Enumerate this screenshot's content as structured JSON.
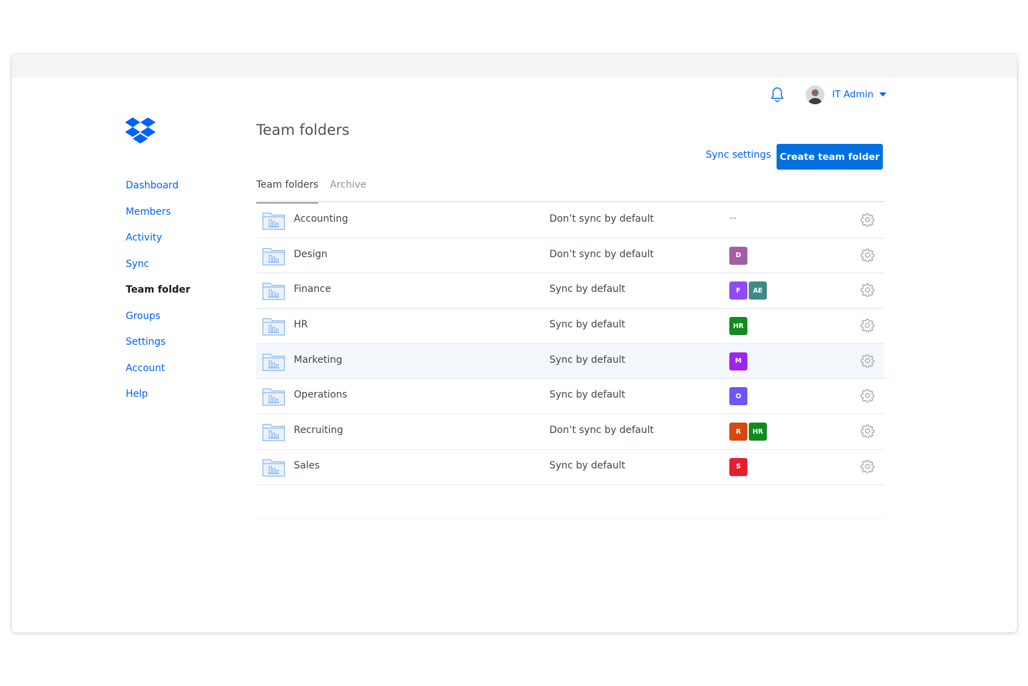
{
  "header": {
    "user_name": "IT Admin",
    "icons": {
      "bell": "bell-icon",
      "avatar": "user-avatar",
      "caret": "chevron-down-icon"
    }
  },
  "brand": {
    "logo": "dropbox-logo",
    "color": "#0061fe"
  },
  "sidebar": {
    "items": [
      {
        "label": "Dashboard",
        "active": false
      },
      {
        "label": "Members",
        "active": false
      },
      {
        "label": "Activity",
        "active": false
      },
      {
        "label": "Sync",
        "active": false
      },
      {
        "label": "Team folder",
        "active": true
      },
      {
        "label": "Groups",
        "active": false
      },
      {
        "label": "Settings",
        "active": false
      },
      {
        "label": "Account",
        "active": false
      },
      {
        "label": "Help",
        "active": false
      }
    ]
  },
  "main": {
    "title": "Team folders",
    "sync_settings_label": "Sync settings",
    "create_button_label": "Create team folder",
    "tabs": [
      {
        "label": "Team folders",
        "active": true
      },
      {
        "label": "Archive",
        "active": false
      }
    ],
    "folders": [
      {
        "name": "Accounting",
        "sync": "Don’t sync by default",
        "empty_groups": "--",
        "groups": []
      },
      {
        "name": "Design",
        "sync": "Don’t sync by default",
        "groups": [
          {
            "label": "D",
            "color": "#a45ea4"
          }
        ]
      },
      {
        "name": "Finance",
        "sync": "Sync by default",
        "groups": [
          {
            "label": "F",
            "color": "#8f4cf5"
          },
          {
            "label": "AE",
            "color": "#3f8a85"
          }
        ]
      },
      {
        "name": "HR",
        "sync": "Sync by default",
        "groups": [
          {
            "label": "HR",
            "color": "#118a1e"
          }
        ]
      },
      {
        "name": "Marketing",
        "sync": "Sync by default",
        "groups": [
          {
            "label": "M",
            "color": "#9f23f0"
          }
        ],
        "hover": true
      },
      {
        "name": "Operations",
        "sync": "Sync by default",
        "groups": [
          {
            "label": "O",
            "color": "#6e55f6"
          }
        ]
      },
      {
        "name": "Recruiting",
        "sync": "Don’t sync by default",
        "groups": [
          {
            "label": "R",
            "color": "#d6490f"
          },
          {
            "label": "HR",
            "color": "#118a1e"
          }
        ]
      },
      {
        "name": "Sales",
        "sync": "Sync by default",
        "groups": [
          {
            "label": "S",
            "color": "#e4202e"
          }
        ]
      }
    ]
  }
}
